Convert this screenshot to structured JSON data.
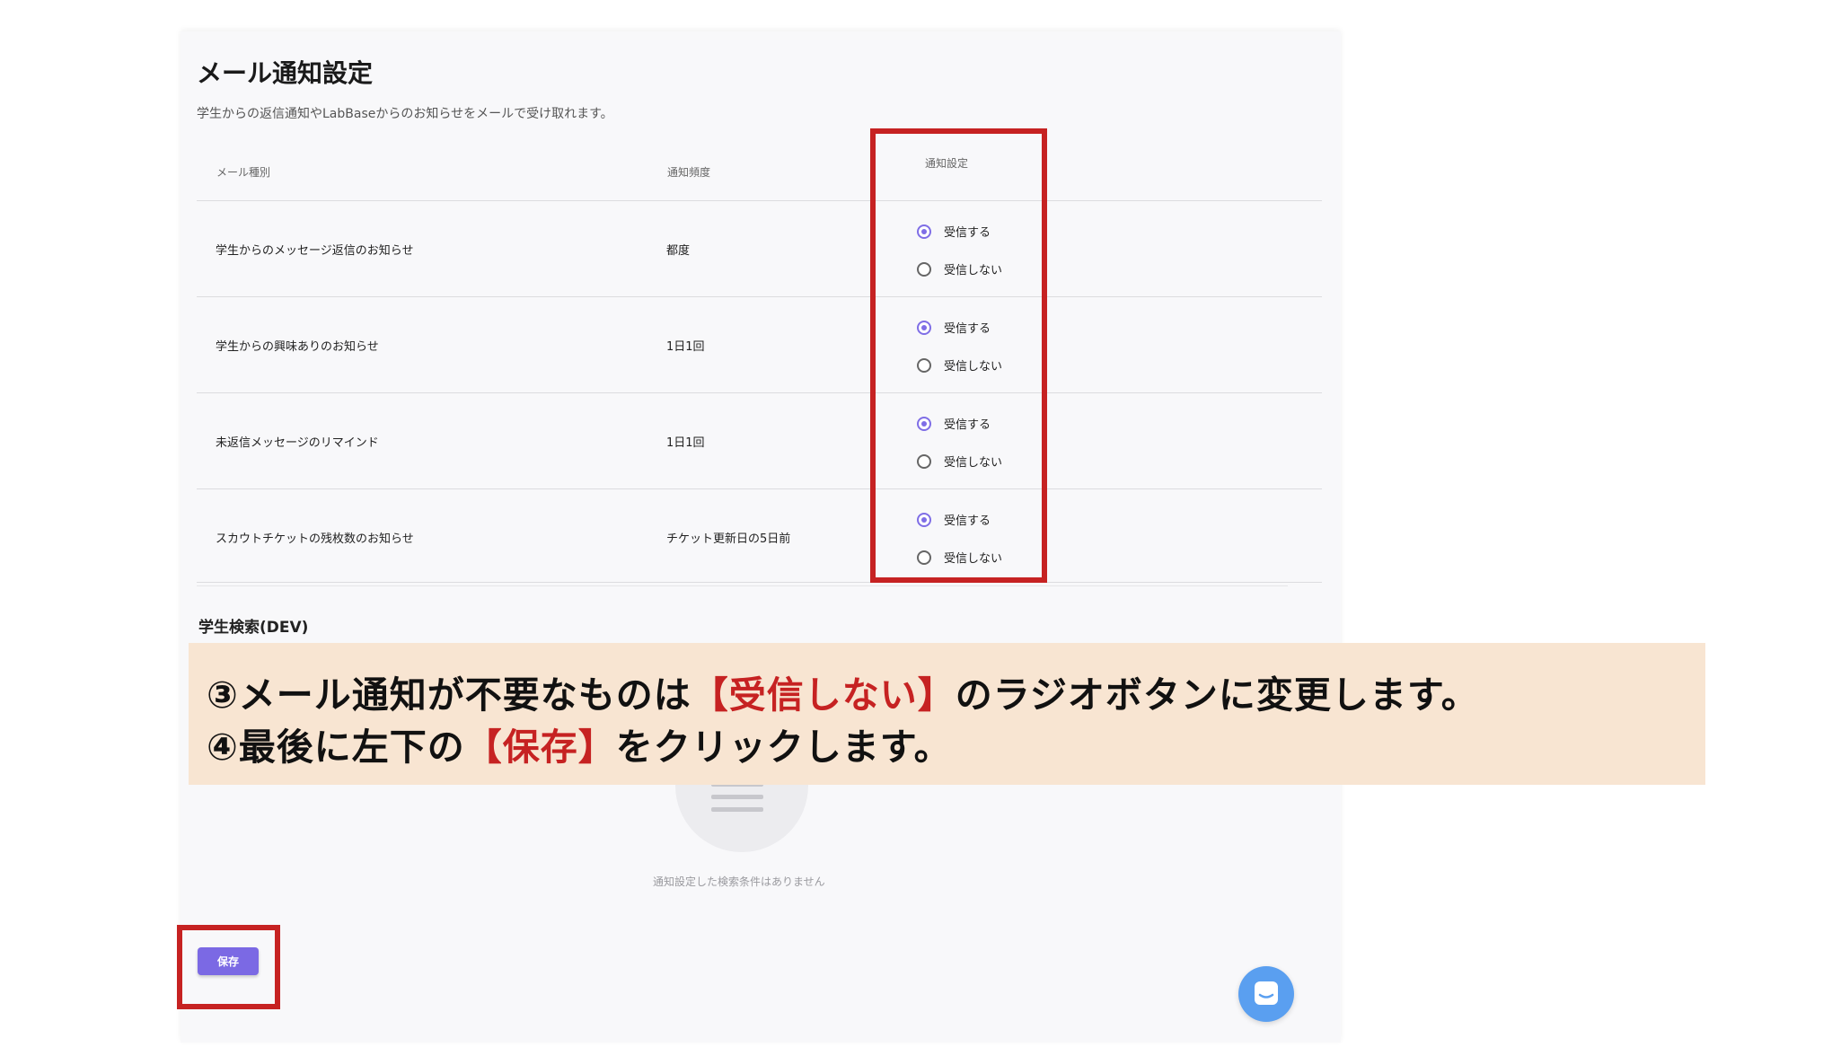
{
  "settings": {
    "title": "メール通知設定",
    "subtitle": "学生からの返信通知やLabBaseからのお知らせをメールで受け取れます。",
    "columns": {
      "type": "メール種別",
      "frequency": "通知頻度",
      "setting": "通知設定"
    },
    "rows": [
      {
        "type": "学生からのメッセージ返信のお知らせ",
        "frequency": "都度",
        "receive": "受信する",
        "no_receive": "受信しない",
        "selected": "receive"
      },
      {
        "type": "学生からの興味ありのお知らせ",
        "frequency": "1日1回",
        "receive": "受信する",
        "no_receive": "受信しない",
        "selected": "receive"
      },
      {
        "type": "未返信メッセージのリマインド",
        "frequency": "1日1回",
        "receive": "受信する",
        "no_receive": "受信しない",
        "selected": "receive"
      },
      {
        "type": "スカウトチケットの残枚数のお知らせ",
        "frequency": "チケット更新日の5日前",
        "receive": "受信する",
        "no_receive": "受信しない",
        "selected": "receive"
      }
    ]
  },
  "student_search": {
    "title": "学生検索(DEV)",
    "empty_text": "通知設定した検索条件はありません",
    "icon": "document-icon"
  },
  "annotation": {
    "line1_pre": "③メール通知が不要なものは",
    "line1_red": "【受信しない】",
    "line1_post": "のラジオボタンに変更します。",
    "line2_pre": "④最後に左下の",
    "line2_red": "【保存】",
    "line2_post": "をクリックします。"
  },
  "actions": {
    "save_label": "保存",
    "chat_icon": "chat-bubble-icon"
  },
  "colors": {
    "accent": "#7b69e4",
    "highlight": "#c62222",
    "annotation_bg": "#f8e5d2",
    "chat": "#5a9ff0"
  }
}
